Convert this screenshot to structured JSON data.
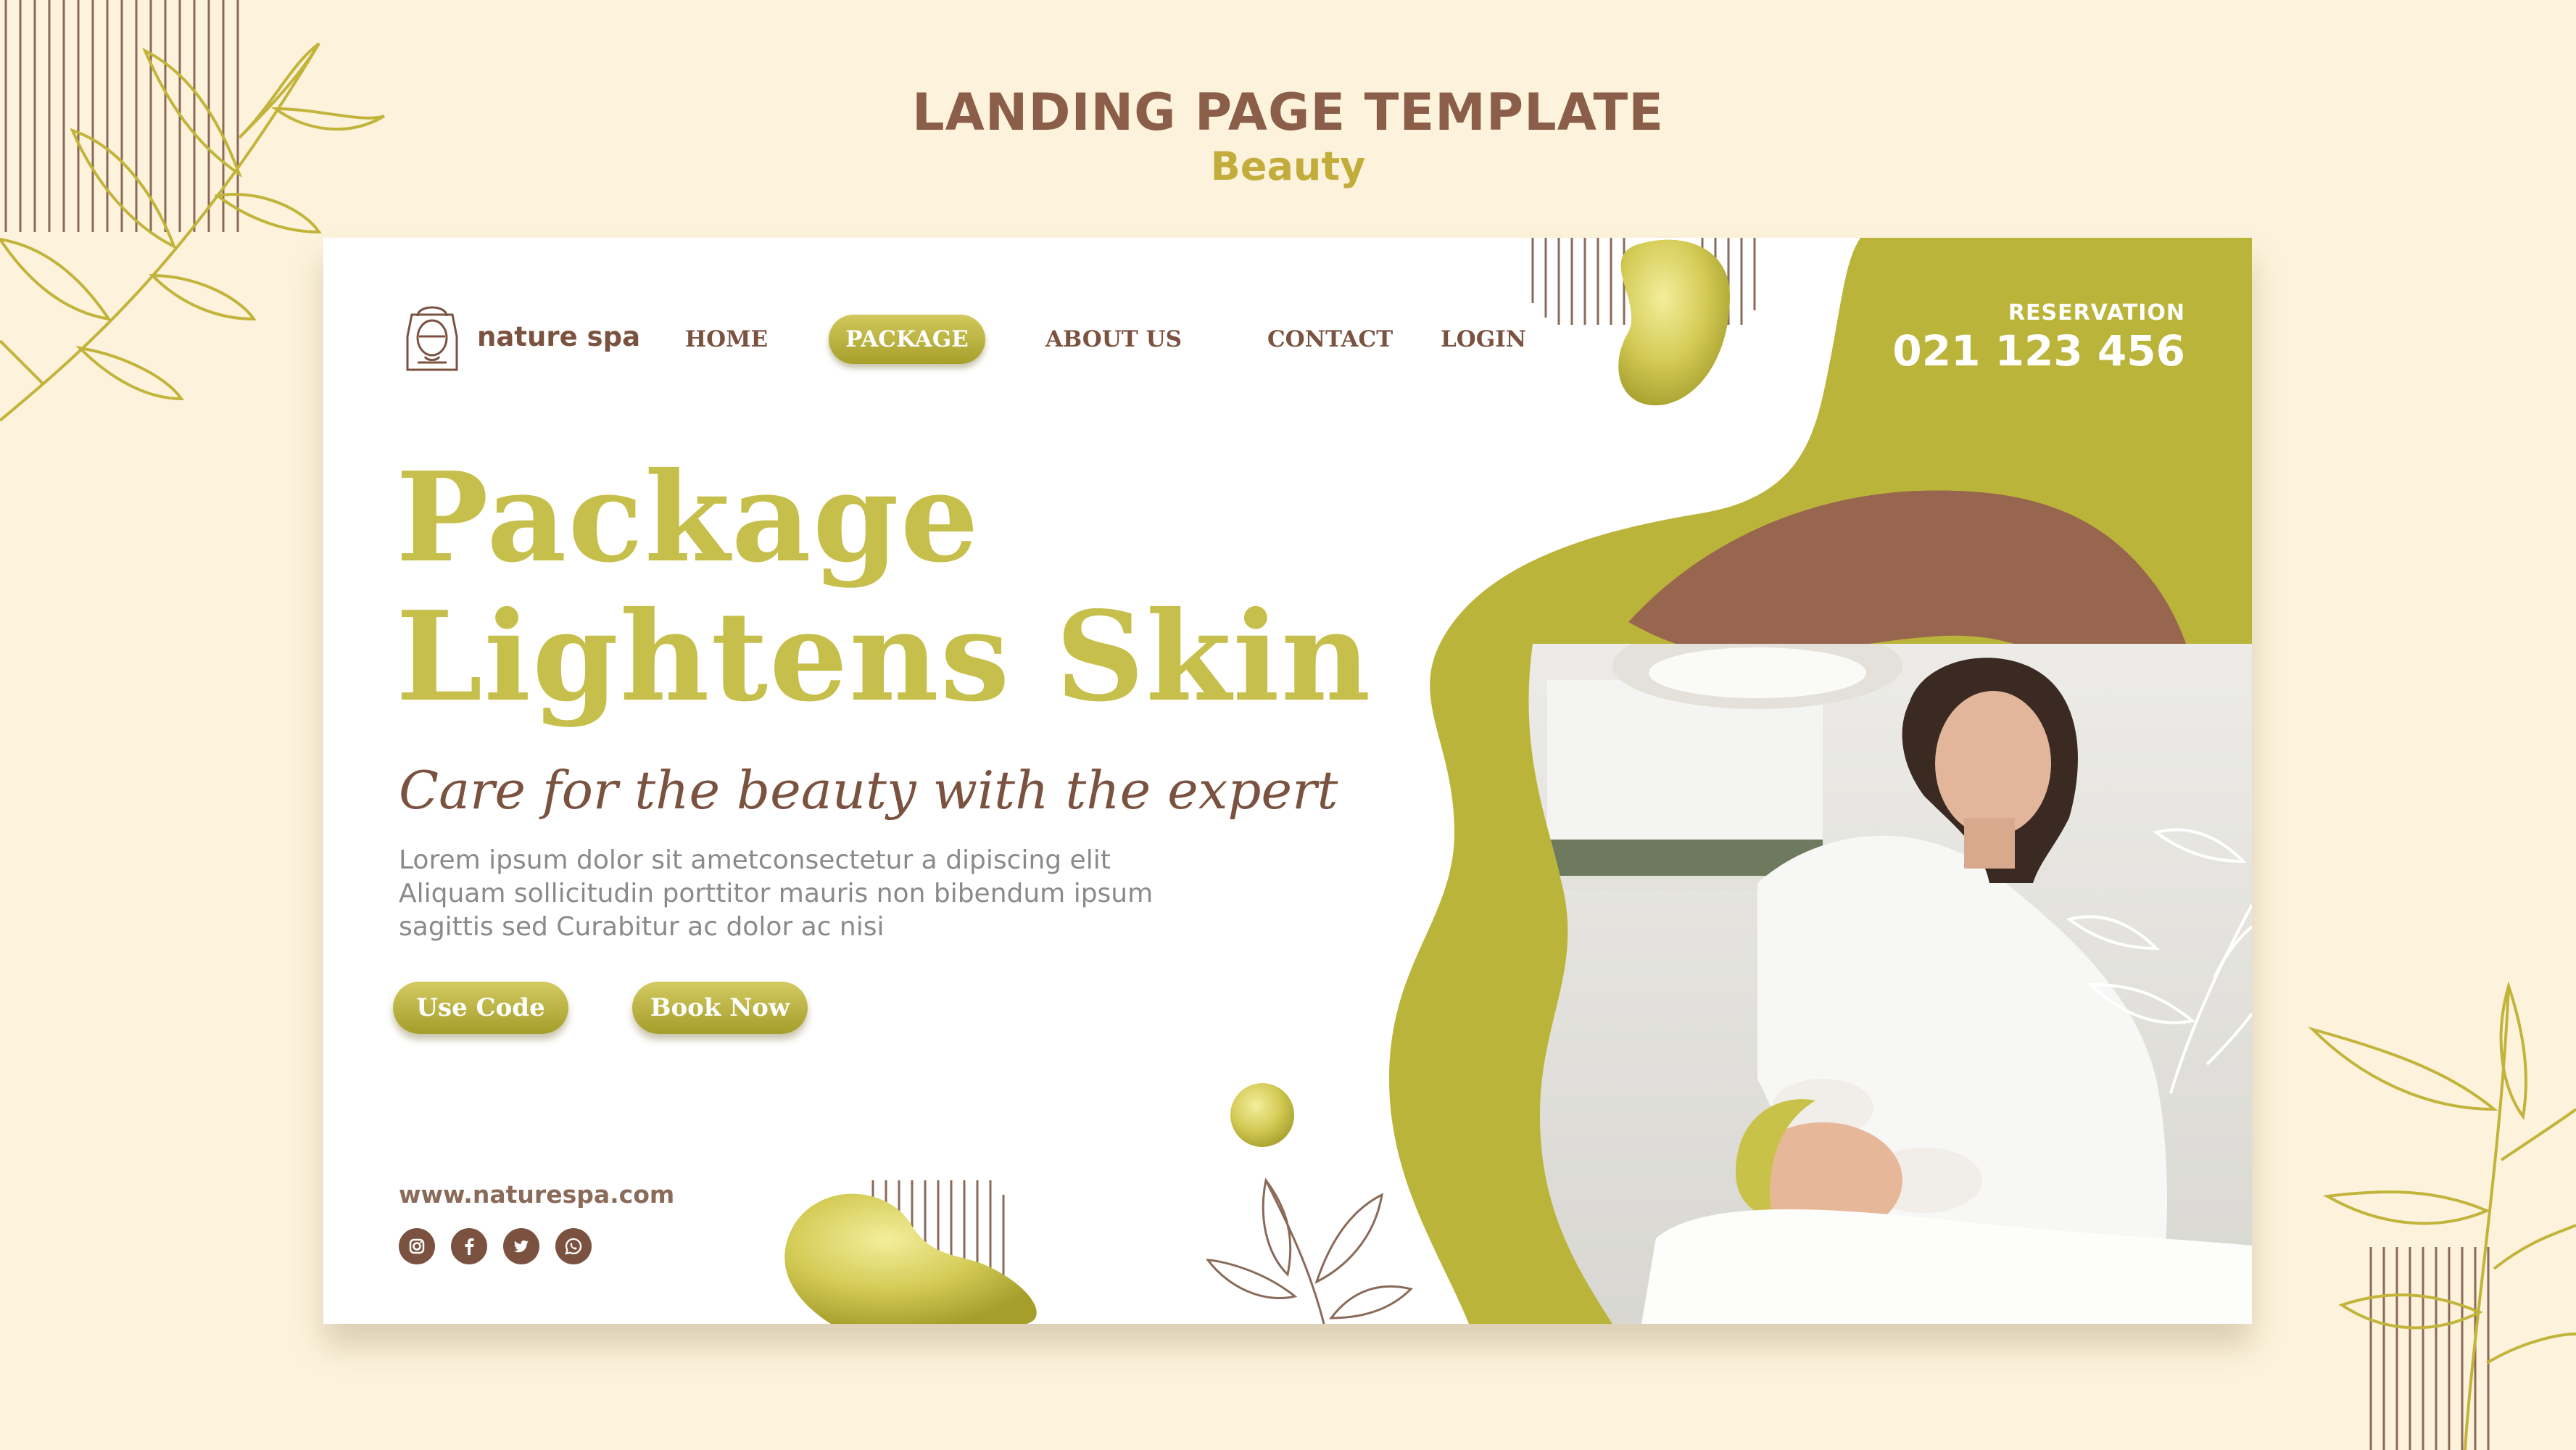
{
  "page_header": {
    "title": "LANDING PAGE TEMPLATE",
    "subtitle": "Beauty"
  },
  "brand": {
    "logo_text": "nature spa"
  },
  "nav": {
    "items": [
      {
        "label": "HOME",
        "active": false
      },
      {
        "label": "PACKAGE",
        "active": true
      },
      {
        "label": "ABOUT US",
        "active": false
      },
      {
        "label": "CONTACT",
        "active": false
      },
      {
        "label": "LOGIN",
        "active": false
      }
    ]
  },
  "reservation": {
    "label": "RESERVATION",
    "phone": "021 123 456"
  },
  "hero": {
    "title_line1": "Package",
    "title_line2": "Lightens Skin",
    "tagline": "Care for the beauty with the expert",
    "body_line1": "Lorem ipsum dolor sit ametconsectetur a dipiscing elit",
    "body_line2": "Aliquam sollicitudin porttitor mauris non bibendum ipsum",
    "body_line3": "sagittis sed Curabitur ac dolor ac nisi",
    "button_use_code": "Use Code",
    "button_book_now": "Book Now"
  },
  "footer": {
    "website": "www.naturespa.com",
    "socials": [
      "instagram-icon",
      "facebook-icon",
      "twitter-icon",
      "whatsapp-icon"
    ]
  },
  "colors": {
    "background": "#fdf3dc",
    "olive": "#c7bf4c",
    "olive_dark": "#a6a02a",
    "brown": "#7b5240",
    "brown_mid": "#98664e"
  }
}
